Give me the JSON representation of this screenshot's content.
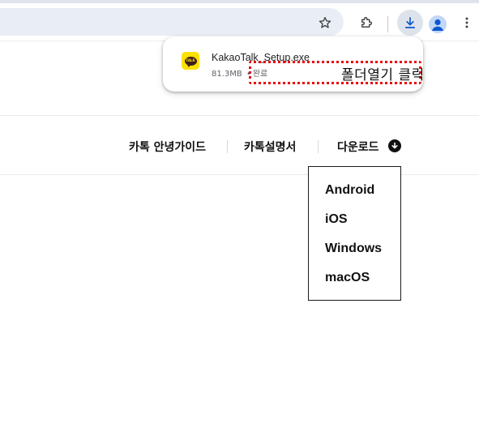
{
  "browser": {
    "icons": {
      "bookmark": "star-icon",
      "extensions": "puzzle-icon",
      "downloads": "download-icon",
      "profile": "profile-icon",
      "menu": "kebab-menu-icon"
    }
  },
  "download_bubble": {
    "filename": "KakaoTalk_Setup.exe",
    "size": "81.3MB",
    "separator": "•",
    "status": "완료",
    "app_icon_text": "TALK"
  },
  "annotation": {
    "label": "폴더열기 클릭",
    "color": "#e8000b"
  },
  "site_nav": {
    "items": [
      {
        "label": "카톡 안녕가이드"
      },
      {
        "label": "카톡설명서"
      },
      {
        "label": "다운로드"
      }
    ]
  },
  "download_menu": {
    "options": [
      "Android",
      "iOS",
      "Windows",
      "macOS"
    ]
  }
}
